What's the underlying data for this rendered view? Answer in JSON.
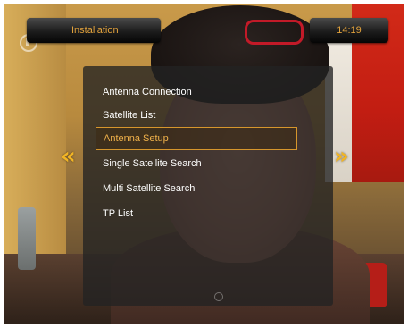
{
  "header": {
    "title": "Installation",
    "clock": "14:19"
  },
  "menu": {
    "items": [
      {
        "label": "Antenna Connection",
        "selected": false
      },
      {
        "label": "Satellite List",
        "selected": false
      },
      {
        "label": "Antenna Setup",
        "selected": true
      },
      {
        "label": "Single Satellite Search",
        "selected": false
      },
      {
        "label": "Multi Satellite Search",
        "selected": false
      },
      {
        "label": "TP List",
        "selected": false
      }
    ]
  },
  "navigation": {
    "left_icon": "double-chevron-left-icon",
    "right_icon": "double-chevron-right-icon",
    "left_glyph": "«",
    "right_glyph": "»"
  },
  "colors": {
    "accent": "#e2a23c",
    "selection_border": "#d6962c",
    "arrow": "#f2b524",
    "menu_text": "#ffffff"
  }
}
